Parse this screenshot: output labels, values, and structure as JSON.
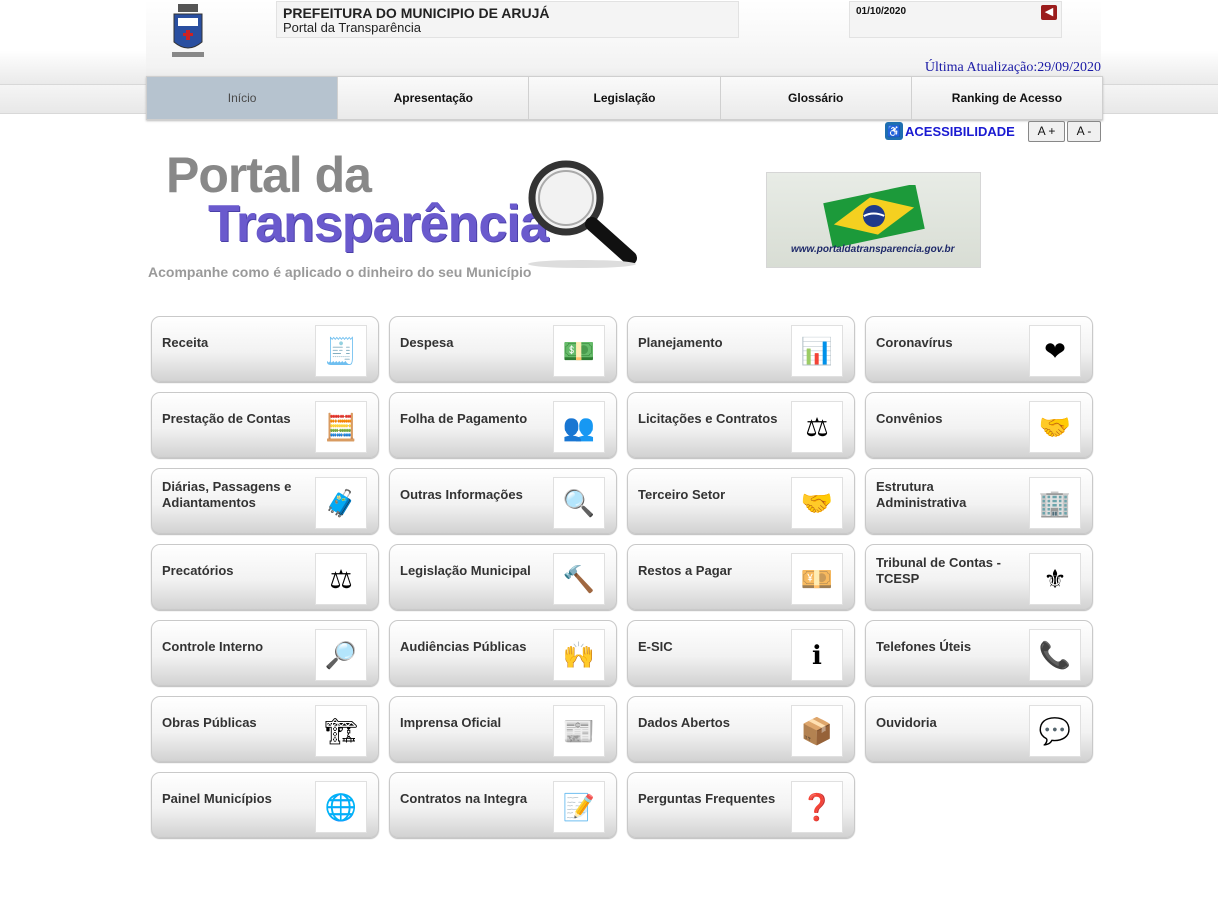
{
  "header": {
    "org_name": "PREFEITURA DO MUNICIPIO DE ARUJÁ",
    "portal_name": "Portal da Transparência",
    "date": "01/10/2020",
    "back_icon": "arrow-left-icon",
    "last_update": "Última Atualização:29/09/2020"
  },
  "nav": {
    "tabs": [
      {
        "label": "Início",
        "active": true
      },
      {
        "label": "Apresentação"
      },
      {
        "label": "Legislação"
      },
      {
        "label": "Glossário"
      },
      {
        "label": "Ranking de Acesso"
      }
    ]
  },
  "accessibility": {
    "label": "ACESSIBILIDADE",
    "font_increase": "A +",
    "font_decrease": "A -"
  },
  "logo": {
    "line1": "Portal da",
    "line2": "Transparência",
    "tagline": "Acompanhe como é aplicado o dinheiro do seu Município",
    "banner_url": "www.portaldatransparencia.gov.br"
  },
  "menu": [
    {
      "label": "Receita",
      "icon": "cash-register-icon",
      "glyph": "🧾"
    },
    {
      "label": "Despesa",
      "icon": "money-icon",
      "glyph": "💵"
    },
    {
      "label": "Planejamento",
      "icon": "chart-icon",
      "glyph": "📊"
    },
    {
      "label": "Coronavírus",
      "icon": "heart-hands-icon",
      "glyph": "❤"
    },
    {
      "label": "Prestação de Contas",
      "icon": "calculator-icon",
      "glyph": "🧮"
    },
    {
      "label": "Folha de Pagamento",
      "icon": "people-icon",
      "glyph": "👥"
    },
    {
      "label": "Licitações e Contratos",
      "icon": "gavel-icon",
      "glyph": "⚖"
    },
    {
      "label": "Convênios",
      "icon": "handshake-icon",
      "glyph": "🤝"
    },
    {
      "label": "Diárias, Passagens e Adiantamentos",
      "icon": "suitcase-icon",
      "glyph": "🧳"
    },
    {
      "label": "Outras Informações",
      "icon": "magnifier-icon",
      "glyph": "🔍"
    },
    {
      "label": "Terceiro Setor",
      "icon": "handshake-figures-icon",
      "glyph": "🤝"
    },
    {
      "label": "Estrutura Administrativa",
      "icon": "org-chart-icon",
      "glyph": "🏢"
    },
    {
      "label": "Precatórios",
      "icon": "scales-icon",
      "glyph": "⚖"
    },
    {
      "label": "Legislação Municipal",
      "icon": "gavel-icon",
      "glyph": "🔨"
    },
    {
      "label": "Restos a Pagar",
      "icon": "banknotes-icon",
      "glyph": "💴"
    },
    {
      "label": "Tribunal de Contas - TCESP",
      "icon": "tcesp-crest-icon",
      "glyph": "⚜"
    },
    {
      "label": "Controle Interno",
      "icon": "inspection-icon",
      "glyph": "🔎"
    },
    {
      "label": "Audiências Públicas",
      "icon": "raised-hands-icon",
      "glyph": "🙌"
    },
    {
      "label": "E-SIC",
      "icon": "info-bubble-icon",
      "glyph": "ℹ"
    },
    {
      "label": "Telefones Úteis",
      "icon": "phone-icon",
      "glyph": "📞"
    },
    {
      "label": "Obras Públicas",
      "icon": "construction-icon",
      "glyph": "🏗"
    },
    {
      "label": "Imprensa Oficial",
      "icon": "newspaper-icon",
      "glyph": "📰"
    },
    {
      "label": "Dados Abertos",
      "icon": "open-data-box-icon",
      "glyph": "📦"
    },
    {
      "label": "Ouvidoria",
      "icon": "contact-channels-icon",
      "glyph": "💬"
    },
    {
      "label": "Painel Municípios",
      "icon": "globe-figure-icon",
      "glyph": "🌐"
    },
    {
      "label": "Contratos na Integra",
      "icon": "signed-document-icon",
      "glyph": "📝"
    },
    {
      "label": "Perguntas Frequentes",
      "icon": "question-mark-icon",
      "glyph": "❓"
    }
  ],
  "colors": {
    "accent_blue": "#1a1aa6",
    "logo_purple": "#6a5acd",
    "active_tab": "#b6c3cf",
    "back_button": "#9b1c1c"
  }
}
